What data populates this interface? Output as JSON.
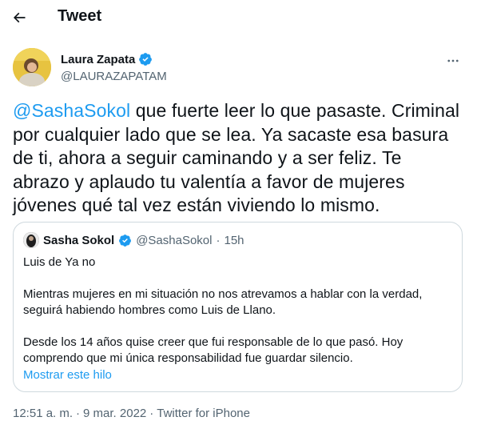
{
  "header": {
    "title": "Tweet",
    "back_icon": "arrow-left-icon"
  },
  "author": {
    "name": "Laura Zapata",
    "handle": "@LAURAZAPATAM",
    "verified_icon": "verified-badge-icon",
    "more_icon": "more-horizontal-icon"
  },
  "tweet": {
    "mention": "@SashaSokol",
    "text": " que fuerte leer lo que pasaste. Criminal por cualquier lado que se lea. Ya sacaste esa basura de ti, ahora a seguir caminando y a ser feliz. Te abrazo y aplaudo tu valentía a favor de mujeres jóvenes qué tal vez están viviendo lo mismo."
  },
  "quote": {
    "name": "Sasha Sokol",
    "handle": "@SashaSokol",
    "separator": "·",
    "time": "15h",
    "paragraphs": [
      "Luis de Ya no",
      "Mientras mujeres en mi situación no nos atrevamos a hablar con la verdad, seguirá habiendo hombres como Luis de Llano.",
      "Desde los 14 años quise creer que fui responsable de lo que pasó. Hoy comprendo que mi única responsabilidad fue guardar silencio."
    ],
    "show_thread": "Mostrar este hilo"
  },
  "meta": {
    "time": "12:51 a. m.",
    "dot1": "·",
    "date": "9 mar. 2022",
    "dot2": "·",
    "source": "Twitter for iPhone"
  },
  "colors": {
    "accent": "#1d9bf0",
    "text": "#0f1419",
    "secondary": "#536471",
    "border": "#cfd9de"
  }
}
